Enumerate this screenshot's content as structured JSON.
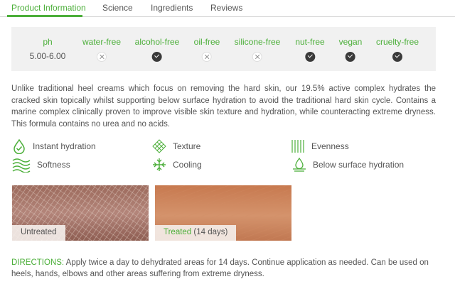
{
  "tabs": [
    {
      "label": "Product Information",
      "active": true
    },
    {
      "label": "Science",
      "active": false
    },
    {
      "label": "Ingredients",
      "active": false
    },
    {
      "label": "Reviews",
      "active": false
    }
  ],
  "attributes": {
    "ph_label": "ph",
    "ph_value": "5.00-6.00",
    "items": [
      {
        "label": "water-free",
        "status": "no"
      },
      {
        "label": "alcohol-free",
        "status": "yes"
      },
      {
        "label": "oil-free",
        "status": "no"
      },
      {
        "label": "silicone-free",
        "status": "no"
      },
      {
        "label": "nut-free",
        "status": "yes"
      },
      {
        "label": "vegan",
        "status": "yes"
      },
      {
        "label": "cruelty-free",
        "status": "yes"
      }
    ]
  },
  "description": "Unlike traditional heel creams which focus on removing the hard skin, our 19.5% active complex hydrates the cracked skin topically whilst supporting below surface hydration to avoid the traditional hard skin cycle. Contains a marine complex clinically proven to improve visible skin texture and hydration, while counteracting extreme dryness. This formula contains no urea and no acids.",
  "benefits": [
    {
      "label": "Instant hydration",
      "icon": "drop-check-icon"
    },
    {
      "label": "Texture",
      "icon": "texture-grid-icon"
    },
    {
      "label": "Evenness",
      "icon": "evenness-lines-icon"
    },
    {
      "label": "Softness",
      "icon": "softness-waves-icon"
    },
    {
      "label": "Cooling",
      "icon": "snowflake-icon"
    },
    {
      "label": "Below surface hydration",
      "icon": "drop-layer-icon"
    }
  ],
  "photos": {
    "untreated_label": "Untreated",
    "treated_label_green": "Treated",
    "treated_label_rest": " (14 days)"
  },
  "directions": {
    "label": "DIRECTIONS:",
    "text": " Apply twice a day to dehydrated areas for 14 days. Continue application as needed. Can be used on heels, hands, elbows and other areas suffering from extreme dryness."
  },
  "colors": {
    "accent": "#4caf3a",
    "panel_bg": "#f1f1f1",
    "text": "#555555",
    "check_bg": "#3a3a3a"
  }
}
